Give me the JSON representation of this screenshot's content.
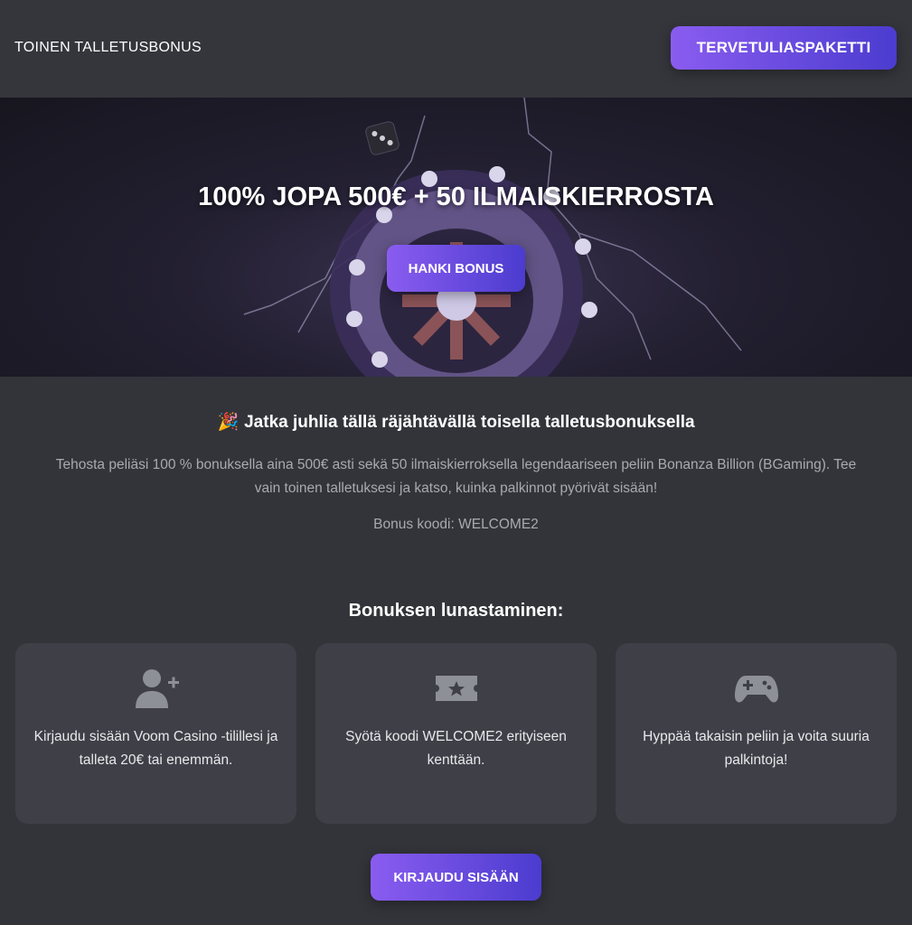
{
  "header": {
    "title": "TOINEN TALLETUSBONUS",
    "cta_label": "TERVETULIASPAKETTI"
  },
  "hero": {
    "title": "100% JOPA 500€ + 50 ILMAISKIERROSTA",
    "button_label": "HANKI BONUS"
  },
  "intro": {
    "title": "Jatka juhlia tällä räjähtävällä toisella talletusbonuksella",
    "description": "Tehosta peliäsi 100 % bonuksella aina 500€ asti sekä 50 ilmaiskierroksella legendaariseen peliin Bonanza Billion (BGaming). Tee vain toinen talletuksesi ja katso, kuinka palkinnot pyörivät sisään!",
    "bonus_code": "Bonus koodi: WELCOME2"
  },
  "steps": {
    "title": "Bonuksen lunastaminen:",
    "items": [
      {
        "icon": "add-user-icon",
        "text": "Kirjaudu sisään Voom Casino -tilillesi ja talleta 20€ tai enemmän."
      },
      {
        "icon": "ticket-star-icon",
        "text": "Syötä koodi WELCOME2 erityiseen kenttään."
      },
      {
        "icon": "gamepad-icon",
        "text": "Hyppää takaisin peliin ja voita suuria palkintoja!"
      }
    ]
  },
  "footer": {
    "login_label": "KIRJAUDU SISÄÄN"
  },
  "colors": {
    "background": "#33343a",
    "card": "#3f4047",
    "accent_start": "#8a5cf0",
    "accent_end": "#4b3ccf",
    "muted_text": "#a9aab1"
  }
}
